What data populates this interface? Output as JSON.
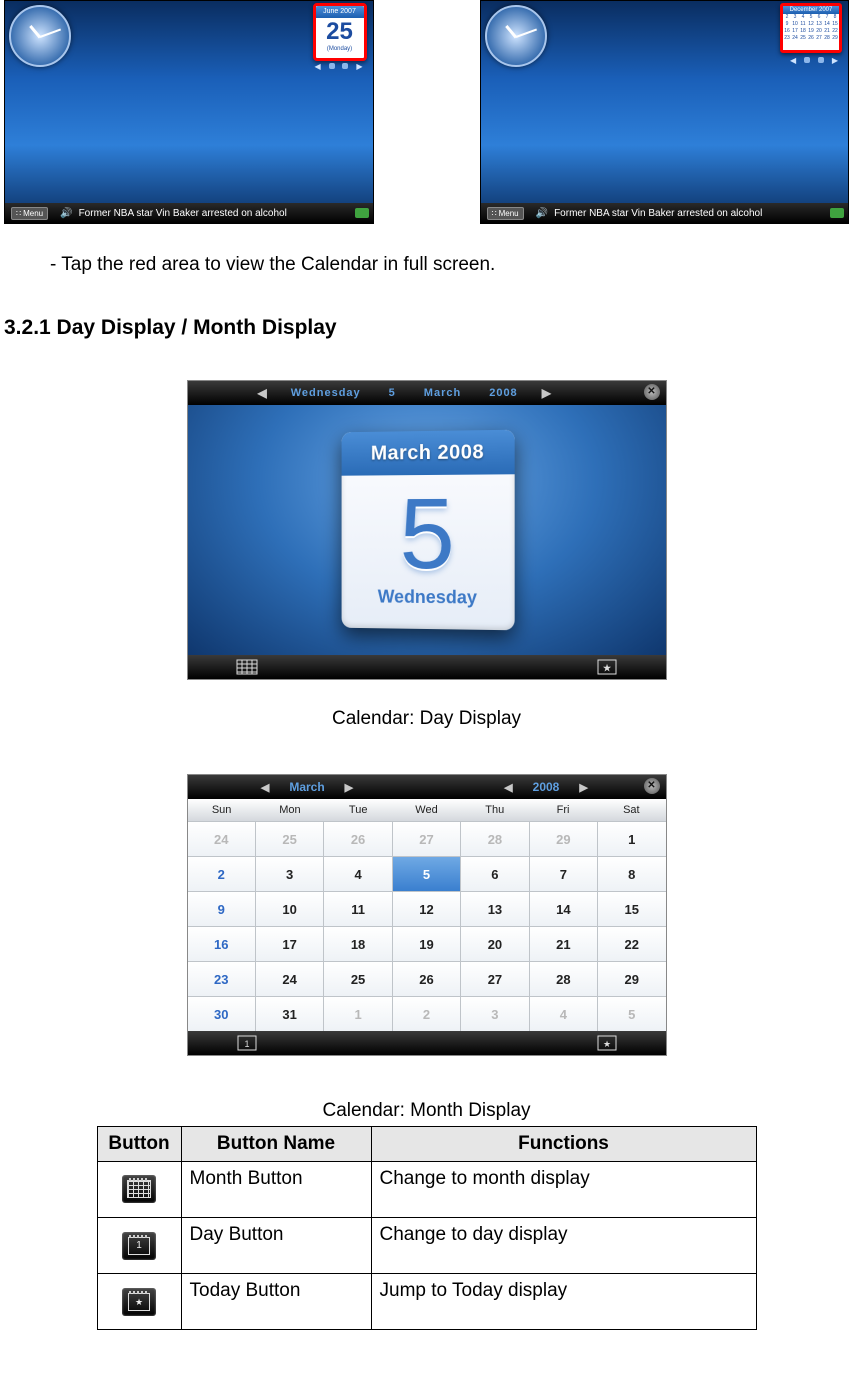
{
  "screenshot_left": {
    "widget_header": "June 2007",
    "widget_day": "25",
    "widget_footer": "(Monday)",
    "menu_label": "Menu",
    "ticker": "Former NBA star Vin Baker arrested on alcohol"
  },
  "screenshot_right": {
    "widget_header": "December 2007",
    "menu_label": "Menu",
    "ticker": "Former NBA star Vin Baker arrested on alcohol",
    "mini_days": [
      "2",
      "3",
      "4",
      "5",
      "6",
      "7",
      "8",
      "9",
      "10",
      "11",
      "12",
      "13",
      "14",
      "15",
      "16",
      "17",
      "18",
      "19",
      "20",
      "21",
      "22",
      "23",
      "24",
      "25",
      "26",
      "27",
      "28",
      "29"
    ]
  },
  "instruction": "- Tap the red area to view the Calendar in full screen.",
  "section_title": "3.2.1 Day Display / Month Display",
  "day_display": {
    "top_date_dow": "Wednesday",
    "top_date_day": "5",
    "top_date_month": "March",
    "top_date_year": "2008",
    "card_header": "March 2008",
    "card_day": "5",
    "card_dow": "Wednesday"
  },
  "caption_day": "Calendar: Day Display",
  "month_display": {
    "month_label": "March",
    "year_label": "2008",
    "dow": [
      "Sun",
      "Mon",
      "Tue",
      "Wed",
      "Thu",
      "Fri",
      "Sat"
    ],
    "cells": [
      {
        "n": "24",
        "dim": true
      },
      {
        "n": "25",
        "dim": true
      },
      {
        "n": "26",
        "dim": true
      },
      {
        "n": "27",
        "dim": true
      },
      {
        "n": "28",
        "dim": true
      },
      {
        "n": "29",
        "dim": true
      },
      {
        "n": "1"
      },
      {
        "n": "2",
        "blue": true
      },
      {
        "n": "3"
      },
      {
        "n": "4"
      },
      {
        "n": "5",
        "sel": true
      },
      {
        "n": "6"
      },
      {
        "n": "7"
      },
      {
        "n": "8"
      },
      {
        "n": "9",
        "blue": true
      },
      {
        "n": "10"
      },
      {
        "n": "11"
      },
      {
        "n": "12"
      },
      {
        "n": "13"
      },
      {
        "n": "14"
      },
      {
        "n": "15"
      },
      {
        "n": "16",
        "blue": true
      },
      {
        "n": "17"
      },
      {
        "n": "18"
      },
      {
        "n": "19"
      },
      {
        "n": "20"
      },
      {
        "n": "21"
      },
      {
        "n": "22"
      },
      {
        "n": "23",
        "blue": true
      },
      {
        "n": "24"
      },
      {
        "n": "25"
      },
      {
        "n": "26"
      },
      {
        "n": "27"
      },
      {
        "n": "28"
      },
      {
        "n": "29"
      },
      {
        "n": "30",
        "blue": true
      },
      {
        "n": "31"
      },
      {
        "n": "1",
        "dim": true
      },
      {
        "n": "2",
        "dim": true
      },
      {
        "n": "3",
        "dim": true
      },
      {
        "n": "4",
        "dim": true
      },
      {
        "n": "5",
        "dim": true
      }
    ]
  },
  "caption_month": "Calendar: Month Display",
  "table": {
    "headers": [
      "Button",
      "Button Name",
      "Functions"
    ],
    "rows": [
      {
        "name": "Month Button",
        "func": "Change to month display",
        "icon": "month"
      },
      {
        "name": "Day Button",
        "func": "Change to day display",
        "icon": "day"
      },
      {
        "name": "Today Button",
        "func": "Jump to Today display",
        "icon": "today"
      }
    ]
  }
}
